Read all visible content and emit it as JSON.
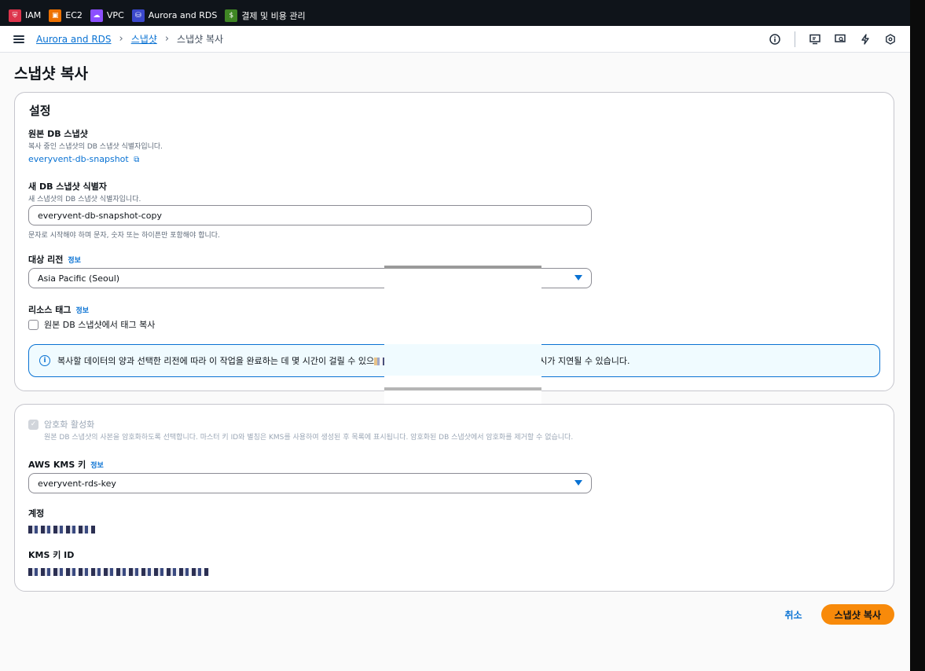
{
  "favorites": [
    {
      "label": "IAM",
      "icon": "iam-icon",
      "color": "#dd344c"
    },
    {
      "label": "EC2",
      "icon": "ec2-icon",
      "color": "#ed7100"
    },
    {
      "label": "VPC",
      "icon": "vpc-icon",
      "color": "#8c4fff"
    },
    {
      "label": "Aurora and RDS",
      "icon": "rds-icon",
      "color": "#3b48cc"
    },
    {
      "label": "결제 및 비용 관리",
      "icon": "billing-icon",
      "color": "#3f8624"
    }
  ],
  "breadcrumb": {
    "items": [
      "Aurora and RDS",
      "스냅샷"
    ],
    "current": "스냅샷 복사"
  },
  "page": {
    "title": "스냅샷 복사"
  },
  "settings": {
    "title": "설정",
    "source": {
      "label": "원본 DB 스냅샷",
      "description": "복사 중인 스냅샷의 DB 스냅샷 식별자입니다.",
      "value": "everyvent-db-snapshot"
    },
    "new_id": {
      "label": "새 DB 스냅샷 식별자",
      "description": "새 스냅샷의 DB 스냅샷 식별자입니다.",
      "value": "everyvent-db-snapshot-copy",
      "hint": "문자로 시작해야 하며 문자, 숫자 또는 하이픈만 포함해야 합니다."
    },
    "region": {
      "label": "대상 리전",
      "info": "정보",
      "value": "Asia Pacific (Seoul)"
    },
    "tags": {
      "label": "리소스 태그",
      "info": "정보",
      "checkbox": "원본 DB 스냅샷에서 태그 복사"
    },
    "alert": {
      "text_start": "복사할 데이터의 양과 선택한 리전에 따라 이 작업을 완료하는 데 몇 시간이 걸릴 수 있으",
      "text_end": "표시가 지연될 수 있습니다."
    }
  },
  "encryption": {
    "checkbox": "암호화 활성화",
    "description": "원본 DB 스냅샷의 사본을 암호화하도록 선택합니다. 마스터 키 ID와 별칭은 KMS를 사용하여 생성된 후 목록에 표시됩니다. 암호화된 DB 스냅샷에서 암호화를 제거할 수 없습니다.",
    "kms_key": {
      "label": "AWS KMS 키",
      "info": "정보",
      "value": "everyvent-rds-key"
    },
    "account_label": "계정",
    "kms_id_label": "KMS 키 ID"
  },
  "actions": {
    "cancel": "취소",
    "submit": "스냅샷 복사"
  }
}
